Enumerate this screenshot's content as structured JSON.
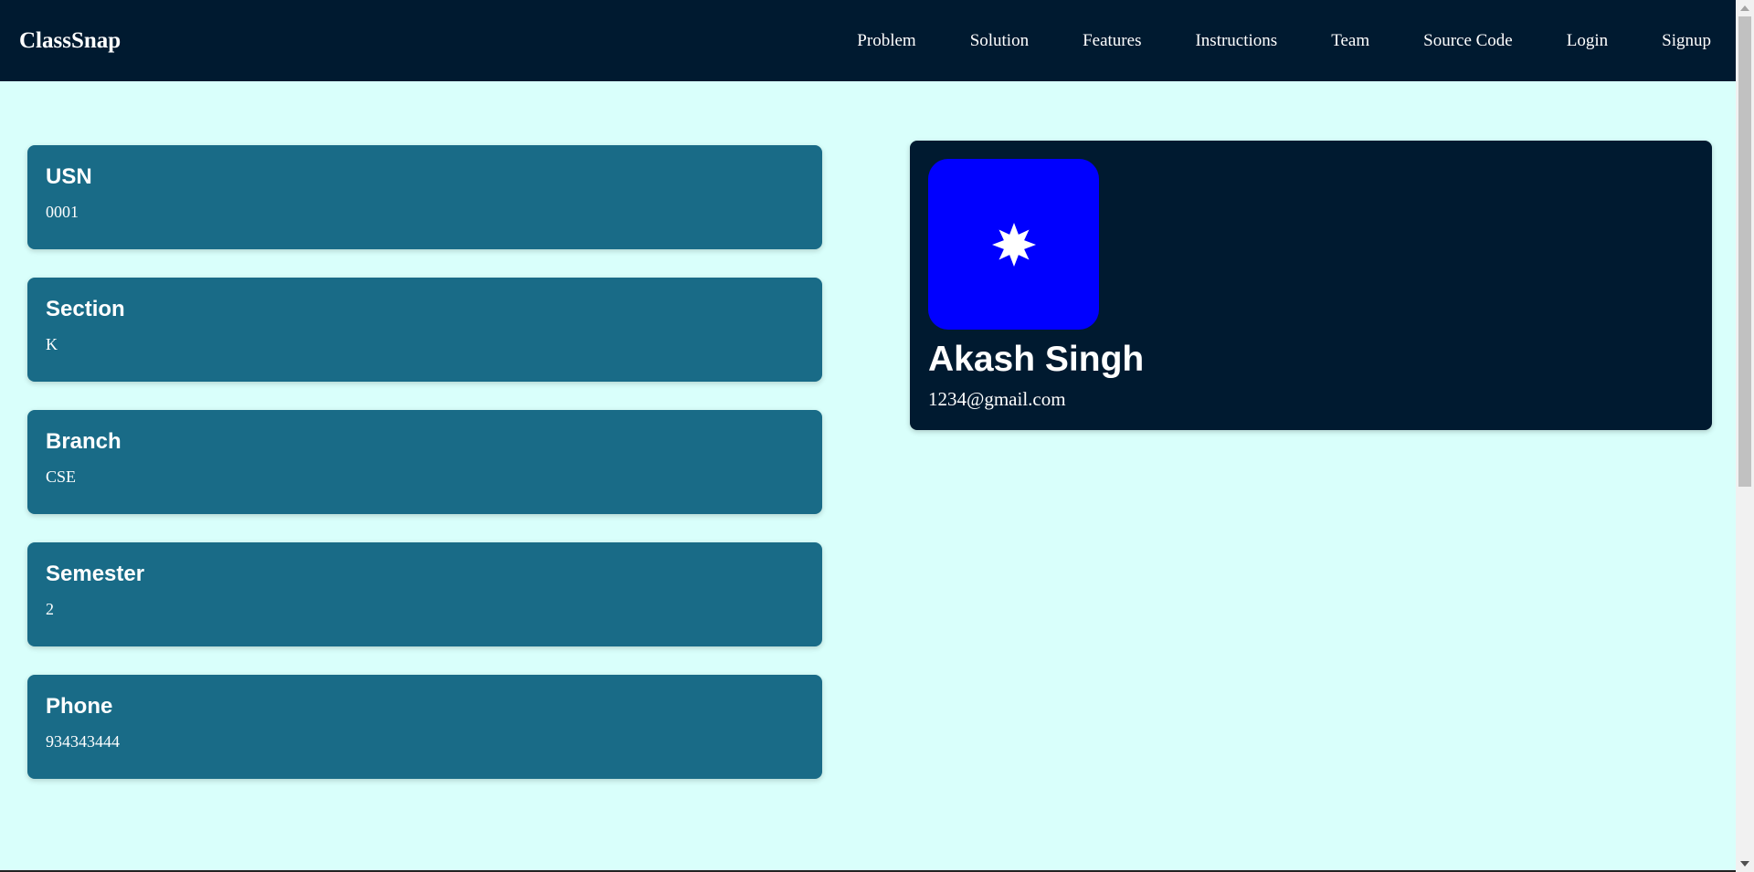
{
  "nav": {
    "brand": "ClassSnap",
    "links": [
      "Problem",
      "Solution",
      "Features",
      "Instructions",
      "Team",
      "Source Code",
      "Login",
      "Signup"
    ]
  },
  "info": [
    {
      "label": "USN",
      "value": "0001"
    },
    {
      "label": "Section",
      "value": "K"
    },
    {
      "label": "Branch",
      "value": "CSE"
    },
    {
      "label": "Semester",
      "value": "2"
    },
    {
      "label": "Phone",
      "value": "934343444"
    }
  ],
  "profile": {
    "name": "Akash Singh",
    "email": "1234@gmail.com",
    "avatar_icon": "star-icon"
  },
  "colors": {
    "nav_bg": "#001a30",
    "page_bg": "#d9fffb",
    "card_bg": "#196b87",
    "avatar_bg": "#0000ff"
  }
}
